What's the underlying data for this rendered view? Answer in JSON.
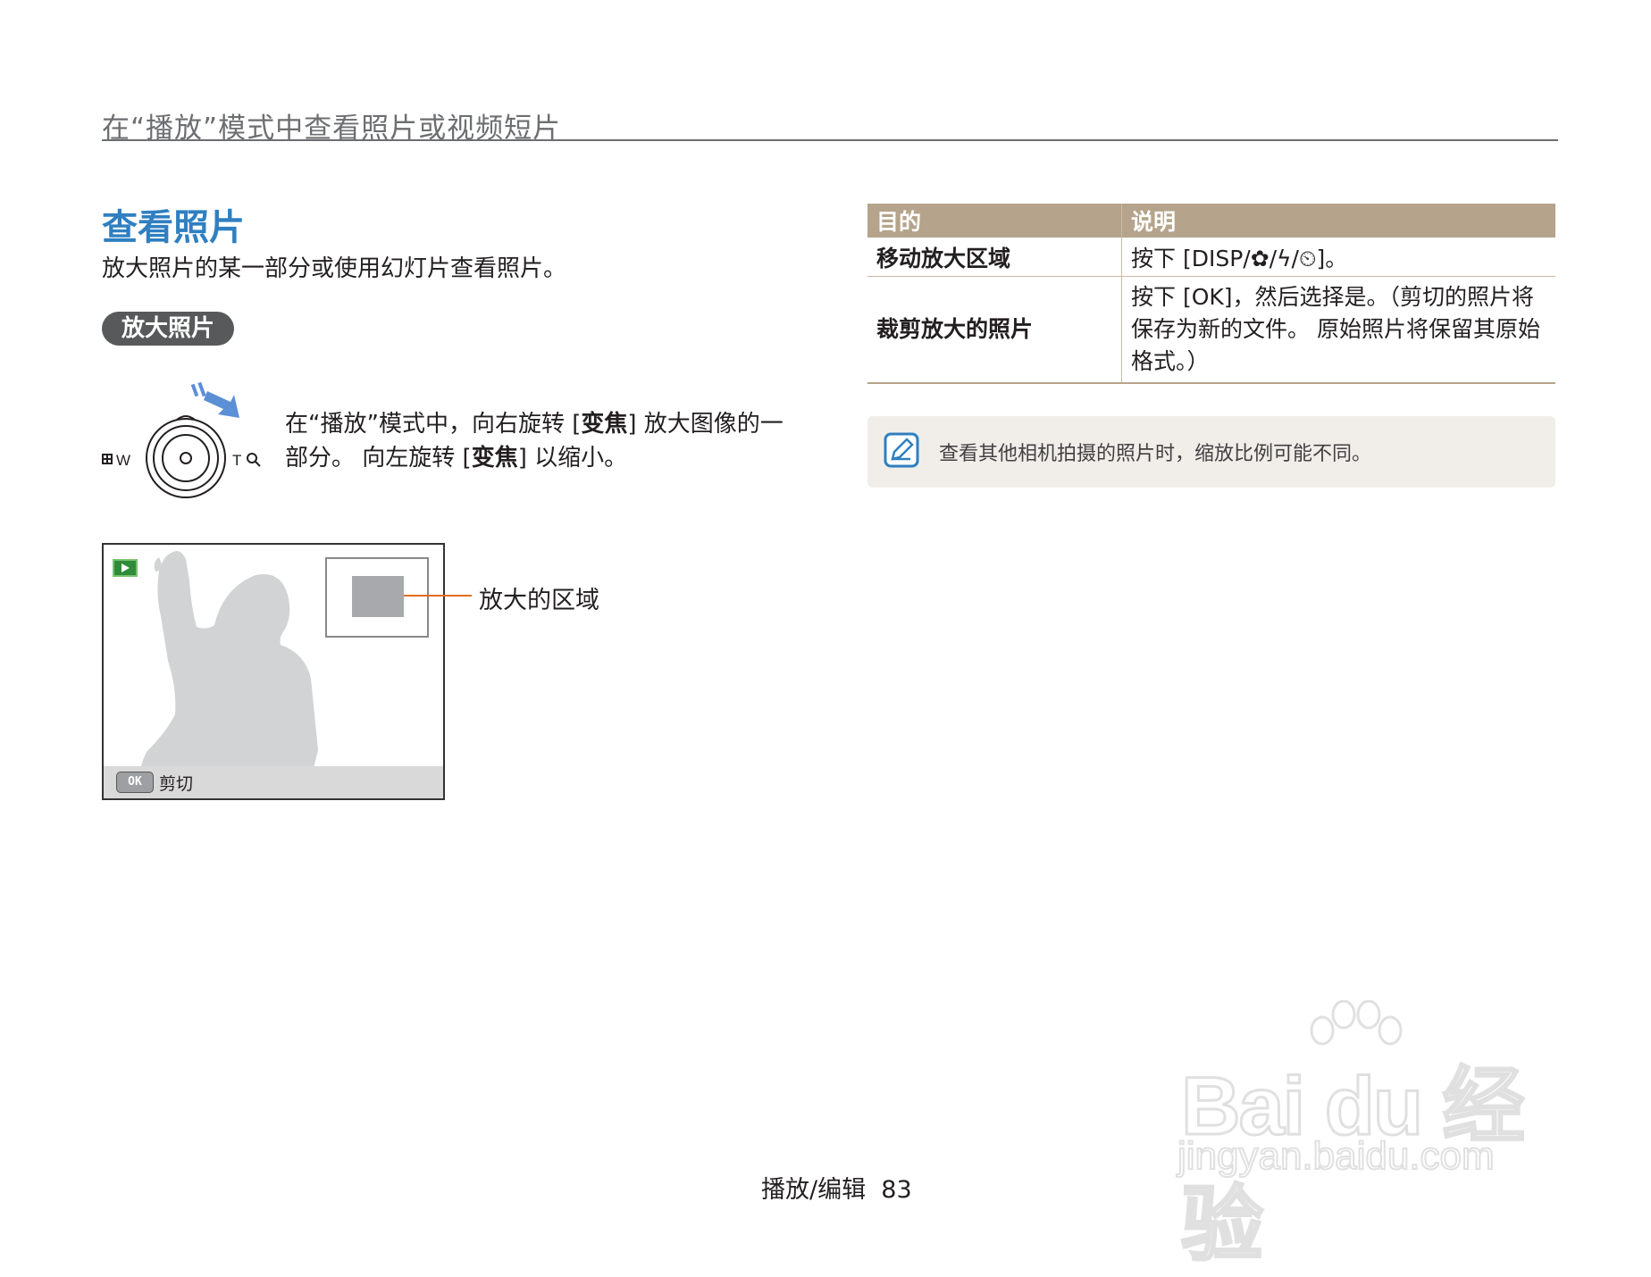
{
  "header": {
    "title": "在“播放”模式中查看照片或视频短片"
  },
  "section": {
    "title": "查看照片",
    "description": "放大照片的某一部分或使用幻灯片查看照片。",
    "subsection_label": "放大照片"
  },
  "dial": {
    "w_label": "W",
    "t_label": "T"
  },
  "zoom_instruction": {
    "part1": "在“播放”模式中，向右旋转 [",
    "bold1": "变焦",
    "part2": "] 放大图像的一部分。 向左旋转 [",
    "bold2": "变焦",
    "part3": "] 以缩小。"
  },
  "screen": {
    "ok_key": "OK",
    "bottom_label": "剪切",
    "callout": "放大的区域"
  },
  "table": {
    "headers": [
      "目的",
      "说明"
    ],
    "rows": [
      {
        "purpose": "移动放大区域",
        "description": "按下 [DISP/✿/ϟ/⏲]。"
      },
      {
        "purpose": "裁剪放大的照片",
        "description": "按下 [OK]，然后选择是。（剪切的照片将保存为新的文件。 原始照片将保留其原始格式。）"
      }
    ]
  },
  "note": {
    "icon": "note-pencil-icon",
    "text": "查看其他相机拍摄的照片时，缩放比例可能不同。"
  },
  "footer": {
    "section": "播放/编辑",
    "page": "83"
  },
  "watermark": {
    "main": "Bai du 经验",
    "sub": "jingyan.baidu.com"
  },
  "colors": {
    "title_blue": "#2f7fc1",
    "table_header": "#b5a48b",
    "callout_orange": "#e36e1d"
  }
}
